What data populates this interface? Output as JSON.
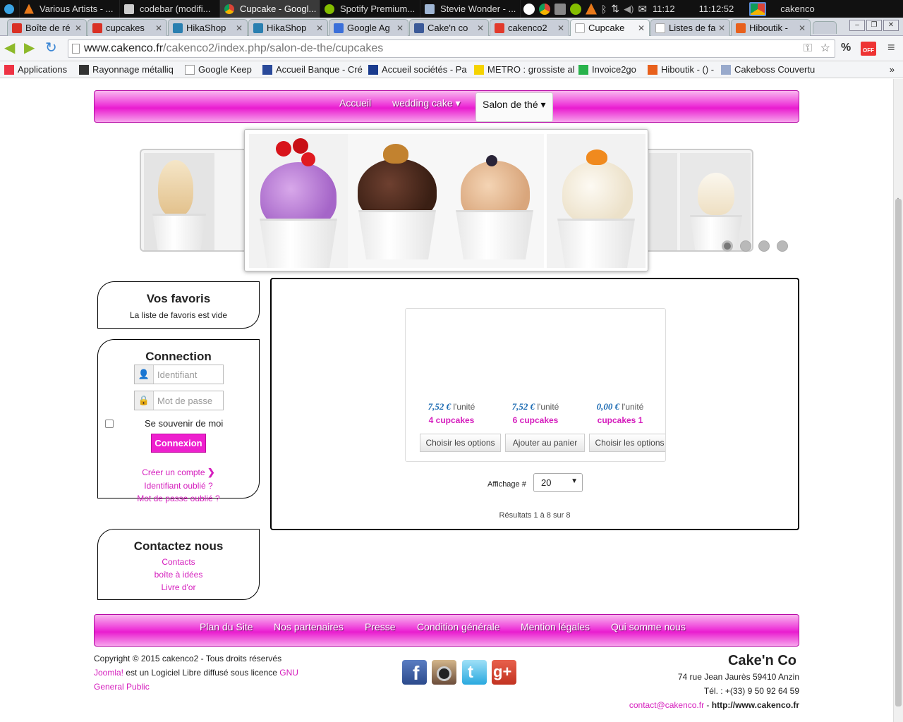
{
  "os": {
    "taskbar_items": [
      {
        "label": "Various Artists - ...",
        "icon": "vlc-icon",
        "color": "#e8791a"
      },
      {
        "label": "codebar (modifi...",
        "icon": "editor-icon",
        "color": "#cccccc"
      },
      {
        "label": "Cupcake - Googl...",
        "icon": "chrome-icon",
        "color": "#4a8af4",
        "active": true
      },
      {
        "label": "Spotify Premium...",
        "icon": "spotify-icon",
        "color": "#84bd00"
      },
      {
        "label": "Stevie Wonder - ...",
        "icon": "folder-icon",
        "color": "#9fb6d4"
      }
    ],
    "clock_short": "11:12",
    "clock_full": "11:12:52",
    "user": "cakenco"
  },
  "browser": {
    "tabs": [
      {
        "label": "Boîte de ré",
        "icon": "gmail-icon",
        "color": "#d93025"
      },
      {
        "label": "cupcakes",
        "icon": "gmail-icon",
        "color": "#d93025"
      },
      {
        "label": "HikaShop",
        "icon": "joomla-icon",
        "color": "#2a7fb0"
      },
      {
        "label": "HikaShop",
        "icon": "joomla-icon",
        "color": "#2a7fb0"
      },
      {
        "label": "Google Ag",
        "icon": "calendar-icon",
        "color": "#3b6fd9"
      },
      {
        "label": "Cake'n co",
        "icon": "facebook-icon",
        "color": "#3b5998"
      },
      {
        "label": "cakenco2",
        "icon": "joomla-icon",
        "color": "#e2392b"
      },
      {
        "label": "Cupcake",
        "icon": "page-icon",
        "color": "#ffffff",
        "active": true
      },
      {
        "label": "Listes de fa",
        "icon": "page-icon",
        "color": "#ffffff"
      },
      {
        "label": "Hiboutik -",
        "icon": "hiboutik-icon",
        "color": "#e8601c"
      }
    ],
    "url_domain": "www.cakenco.fr",
    "url_path": "/cakenco2/index.php/salon-de-the/cupcakes",
    "bookmarks": [
      {
        "label": "Applications",
        "icon": "apps-icon",
        "color": "#e34"
      },
      {
        "label": "Rayonnage métalliq",
        "icon": "bookmark-icon",
        "color": "#333"
      },
      {
        "label": "Google Keep",
        "icon": "page-icon",
        "color": "#fff"
      },
      {
        "label": "Accueil Banque - Cré",
        "icon": "bank-icon",
        "color": "#2a4a9a"
      },
      {
        "label": "Accueil sociétés - Pa",
        "icon": "paypal-icon",
        "color": "#1a3b8e"
      },
      {
        "label": "METRO : grossiste al",
        "icon": "metro-icon",
        "color": "#f5d300"
      },
      {
        "label": "Invoice2go",
        "icon": "invoice-icon",
        "color": "#28b34b"
      },
      {
        "label": "Hiboutik - () -",
        "icon": "hiboutik-icon",
        "color": "#e8601c"
      },
      {
        "label": "Cakeboss Couvertur",
        "icon": "cakeboss-icon",
        "color": "#9ac"
      }
    ],
    "more": "»"
  },
  "site": {
    "menu": {
      "home": "Accueil",
      "wedding": "wedding cake",
      "salon": "Salon de thé"
    },
    "favorites": {
      "title": "Vos favoris",
      "empty": "La liste de favoris est vide"
    },
    "login": {
      "title": "Connection",
      "username_placeholder": "Identifiant",
      "password_placeholder": "Mot de passe",
      "remember": "Se souvenir de moi",
      "submit": "Connexion",
      "create": "Créer un compte",
      "forgot_user": "Identifiant oublié ?",
      "forgot_pass": "Mot de passe oublié ?"
    },
    "contact": {
      "title": "Contactez nous",
      "links": [
        "Contacts",
        "boîte à idées",
        "Livre d'or"
      ]
    },
    "products": [
      {
        "price": "7,52 €",
        "unit": "l'unité",
        "name": "4 cupcakes",
        "button": "Choisir les options"
      },
      {
        "price": "7,52 €",
        "unit": "l'unité",
        "name": "6 cupcakes",
        "button": "Ajouter au panier"
      },
      {
        "price": "0,00 €",
        "unit": "l'unité",
        "name": "cupcakes 1",
        "button": "Choisir les options"
      }
    ],
    "display_label": "Affichage #",
    "display_value": "20",
    "results": "Résultats 1 à 8 sur 8",
    "footer_menu": [
      "Plan du Site",
      "Nos partenaires",
      "Presse",
      "Condition générale",
      "Mention légales",
      "Qui somme nous"
    ],
    "copyright": "Copyright © 2015 cakenco2 - Tous droits réservés",
    "joomla": "Joomla!",
    "license_text": " est un Logiciel Libre diffusé sous licence ",
    "gnu": "GNU General Public",
    "company": "Cake'n Co",
    "address": "74 rue Jean Jaurès 59410 Anzin",
    "phone": "Tél. : +(33) 9 50 92 64 59",
    "email": "contact@cakenco.fr",
    "web_sep": " - ",
    "web": "http://www.cakenco.fr",
    "colors": {
      "pink": "#ee1fce",
      "link": "#d51dbd",
      "price": "#1e6cb3"
    }
  }
}
